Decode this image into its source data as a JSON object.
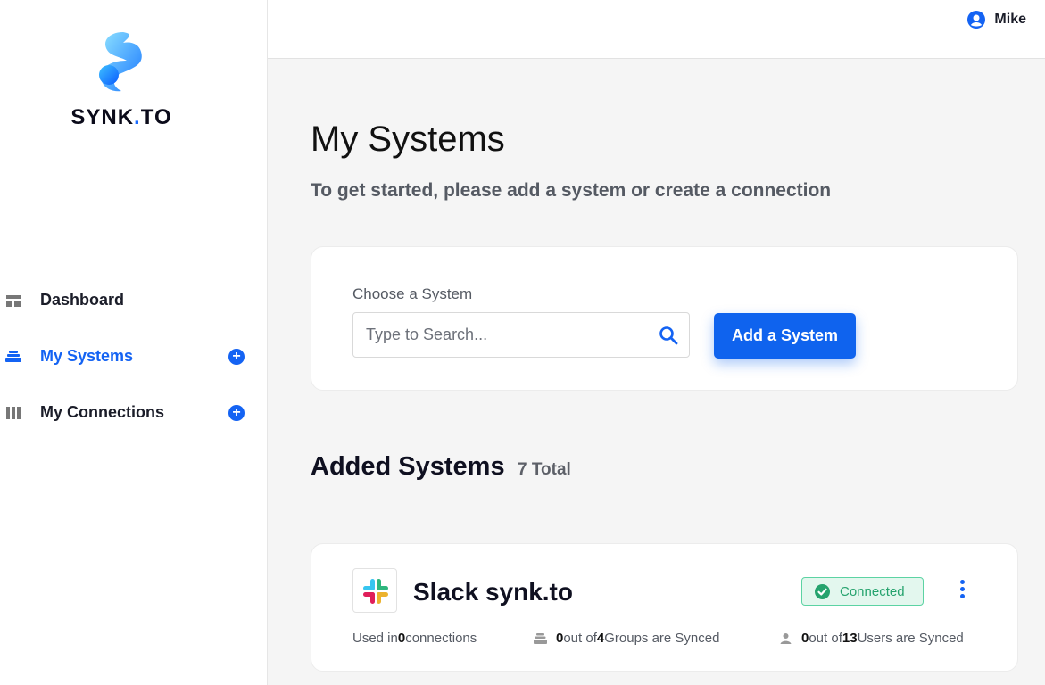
{
  "brand": {
    "name_part1": "SYNK",
    "name_dot": ".",
    "name_part2": "TO"
  },
  "sidebar": {
    "items": [
      {
        "label": "Dashboard",
        "icon": "dashboard-icon",
        "active": false,
        "has_add": false
      },
      {
        "label": "My Systems",
        "icon": "systems-stack-icon",
        "active": true,
        "has_add": true
      },
      {
        "label": "My Connections",
        "icon": "connections-columns-icon",
        "active": false,
        "has_add": true
      }
    ]
  },
  "header": {
    "user_name": "Mike",
    "user_icon": "user-circle-icon"
  },
  "main": {
    "title": "My Systems",
    "subtitle": "To get started, please add a system or create a connection",
    "choose": {
      "label": "Choose a System",
      "search_placeholder": "Type to Search...",
      "search_value": "",
      "add_button": "Add a System"
    },
    "added": {
      "title": "Added Systems",
      "count": "7 Total"
    },
    "systems": [
      {
        "name": "Slack synk.to",
        "logo": "slack-logo",
        "status": "Connected",
        "status_color": "#26a36e",
        "stats": {
          "connections_prefix": "Used in ",
          "connections_count": "0",
          "connections_suffix": " connections",
          "groups_synced": "0",
          "groups_mid": " out of ",
          "groups_total": "4",
          "groups_suffix": " Groups are Synced",
          "users_synced": "0",
          "users_mid": " out of ",
          "users_total": "13",
          "users_suffix": " Users are Synced"
        }
      }
    ]
  },
  "colors": {
    "accent": "#1463f3",
    "button": "#0f63ee",
    "success_bg": "#e3f7ee",
    "success_border": "#5cd3a3"
  }
}
